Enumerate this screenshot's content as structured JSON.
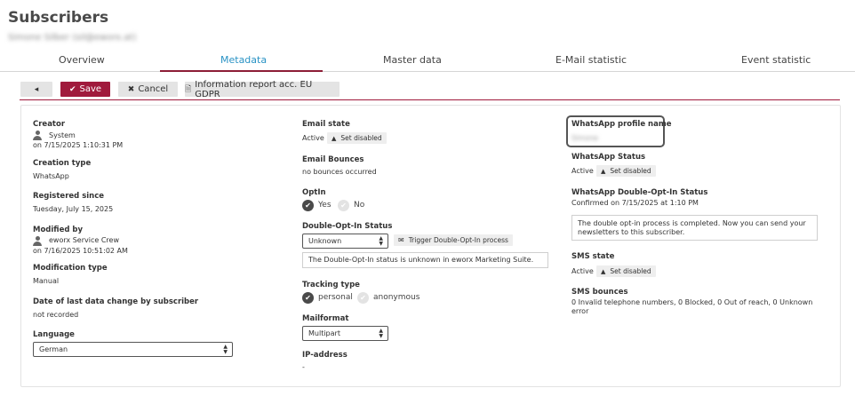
{
  "page": {
    "title": "Subscribers",
    "subtitle": "Simone Silber (sil@eworx.at)"
  },
  "tabs": [
    {
      "label": "Overview"
    },
    {
      "label": "Metadata"
    },
    {
      "label": "Master data"
    },
    {
      "label": "E-Mail statistic"
    },
    {
      "label": "Event statistic"
    }
  ],
  "toolbar": {
    "back_icon": "◂",
    "save_label": "Save",
    "save_icon": "✔",
    "cancel_label": "Cancel",
    "cancel_icon": "✖",
    "gdpr_label": "Information report acc. EU GDPR",
    "gdpr_icon": "🗎"
  },
  "left": {
    "creator_label": "Creator",
    "creator_name": "System",
    "creator_date": "on 7/15/2025 1:10:31 PM",
    "creation_type_label": "Creation type",
    "creation_type": "WhatsApp",
    "registered_label": "Registered since",
    "registered": "Tuesday, July 15, 2025",
    "modified_label": "Modified by",
    "modified_name": "eworx Service Crew",
    "modified_date": "on 7/16/2025 10:51:02 AM",
    "mod_type_label": "Modification type",
    "mod_type": "Manual",
    "last_change_label": "Date of last data change by subscriber",
    "last_change": "not recorded",
    "language_label": "Language",
    "language": "German"
  },
  "middle": {
    "email_state_label": "Email state",
    "email_state": "Active",
    "set_disabled": "Set disabled",
    "email_bounces_label": "Email Bounces",
    "email_bounces": "no bounces occurred",
    "optin_label": "OptIn",
    "optin_yes": "Yes",
    "optin_no": "No",
    "doi_label": "Double-Opt-In Status",
    "doi_value": "Unknown",
    "doi_trigger": "Trigger Double-Opt-In process",
    "doi_info": "The Double-Opt-In status is unknown in eworx Marketing Suite.",
    "tracking_label": "Tracking type",
    "tracking_personal": "personal",
    "tracking_anonymous": "anonymous",
    "mailformat_label": "Mailformat",
    "mailformat": "Multipart",
    "ip_label": "IP-address",
    "ip": "-"
  },
  "right": {
    "wa_profile_label": "WhatsApp profile name",
    "wa_profile": "Simone",
    "wa_status_label": "WhatsApp Status",
    "wa_status": "Active",
    "set_disabled": "Set disabled",
    "wa_doi_label": "WhatsApp Double-Opt-In Status",
    "wa_doi": "Confirmed on 7/15/2025 at 1:10 PM",
    "wa_doi_info_1": "The double opt-in process is completed. Now you can send your",
    "wa_doi_info_2": "newsletters to this subscriber.",
    "sms_state_label": "SMS state",
    "sms_state": "Active",
    "sms_bounces_label": "SMS bounces",
    "sms_bounces_1": "0 Invalid telephone numbers, 0 Blocked, 0 Out of reach, 0 Unknown",
    "sms_bounces_2": "error"
  },
  "colors": {
    "accent": "#a01a3c",
    "tab_active": "#2a93c5"
  }
}
